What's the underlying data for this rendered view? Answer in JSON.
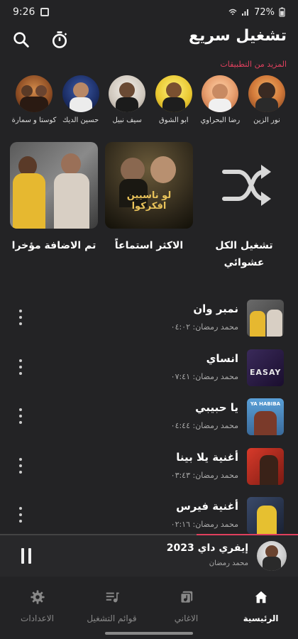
{
  "status": {
    "time": "9:26",
    "battery": "72%"
  },
  "header": {
    "title": "تشغيل سريع"
  },
  "section_more": "المزيد من التطبيقات",
  "artists": [
    {
      "name": "نور الزين"
    },
    {
      "name": "رضا البحراوي"
    },
    {
      "name": "ابو الشوق"
    },
    {
      "name": "سيف نبيل"
    },
    {
      "name": "حسين الديك"
    },
    {
      "name": "كوستا و سمارة"
    }
  ],
  "quick_cards": [
    {
      "label": "تشغيل الكل عشوائي",
      "type": "shuffle-icon"
    },
    {
      "label": "الاكثر استماعاً",
      "art_text": "لو ناسيين افكركوا"
    },
    {
      "label": "تم الاضافة مؤخرا"
    }
  ],
  "songs": [
    {
      "title": "نمبر وان",
      "sub": "محمد رمضان: ٠٤:٠٢"
    },
    {
      "title": "انساي",
      "sub": "محمد رمضان: ٠٧:٤١"
    },
    {
      "title": "يا حبيبي",
      "sub": "محمد رمضان: ٠٤:٤٤"
    },
    {
      "title": "أغنية يلا بينا",
      "sub": "محمد رمضان: ٠٣:٤٣"
    },
    {
      "title": "أغنية فيرس",
      "sub": "محمد رمضان: ٠٢:١٦"
    }
  ],
  "now_playing": {
    "title": "إيفري داي 2023",
    "artist": "محمد رمضان",
    "progress": 0.34
  },
  "nav": [
    {
      "label": "الرئيسية",
      "icon": "home-icon",
      "active": true
    },
    {
      "label": "الاغاني",
      "icon": "songs-icon",
      "active": false
    },
    {
      "label": "قوائم التشغيل",
      "icon": "playlist-icon",
      "active": false
    },
    {
      "label": "الاعدادات",
      "icon": "settings-icon",
      "active": false
    }
  ],
  "colors": {
    "accent": "#e0405e",
    "background": "#232325"
  }
}
